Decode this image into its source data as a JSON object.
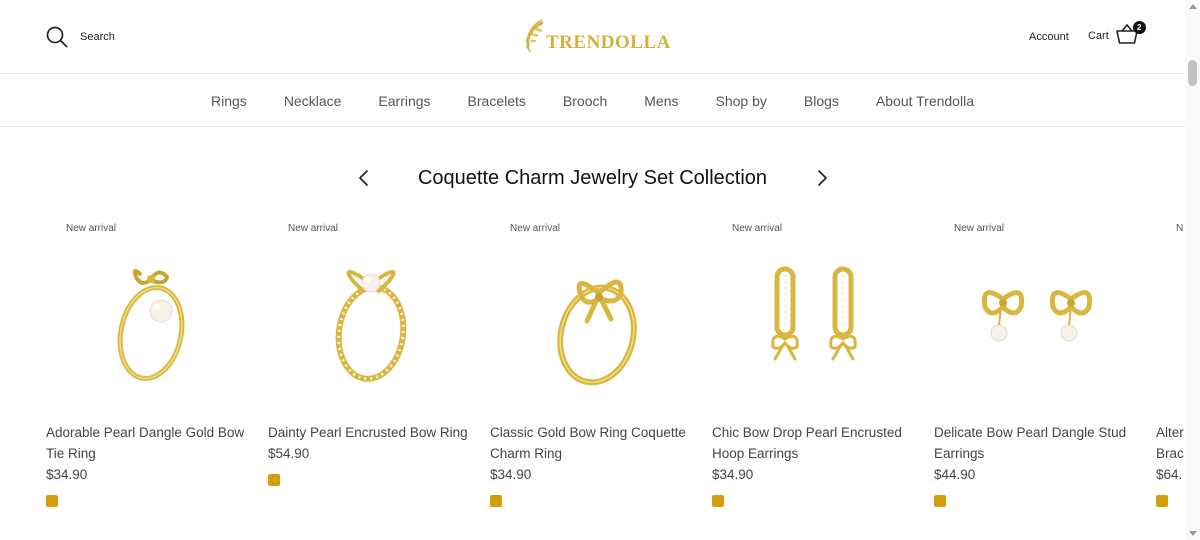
{
  "header": {
    "search_label": "Search",
    "logo_text": "TRENDOLLA",
    "account_label": "Account",
    "cart_label": "Cart",
    "cart_count": "2"
  },
  "nav": {
    "items": [
      "Rings",
      "Necklace",
      "Earrings",
      "Bracelets",
      "Brooch",
      "Mens",
      "Shop by",
      "Blogs",
      "About Trendolla"
    ]
  },
  "collection": {
    "title": "Coquette Charm Jewelry Set Collection"
  },
  "products": [
    {
      "badge": "New arrival",
      "name": "Adorable Pearl Dangle Gold Bow Tie Ring",
      "price": "$34.90",
      "image": "ring-pearl-dangle"
    },
    {
      "badge": "New arrival",
      "name": "Dainty Pearl Encrusted Bow Ring",
      "price": "$54.90",
      "image": "ring-pearl-encrusted-bow"
    },
    {
      "badge": "New arrival",
      "name": "Classic Gold Bow Ring Coquette Charm Ring",
      "price": "$34.90",
      "image": "ring-gold-bow"
    },
    {
      "badge": "New arrival",
      "name": "Chic Bow Drop Pearl Encrusted Hoop Earrings",
      "price": "$34.90",
      "image": "hoop-earrings-bow"
    },
    {
      "badge": "New arrival",
      "name": "Delicate Bow Pearl Dangle Stud Earrings",
      "price": "$44.90",
      "image": "stud-earrings-bow-pearl"
    },
    {
      "badge": "N",
      "name": "Alter Brac",
      "price": "$64.",
      "image": "bracelet-partial"
    }
  ],
  "colors": {
    "brand_gold": "#d4b13a",
    "swatch_gold": "#d49d0b"
  }
}
